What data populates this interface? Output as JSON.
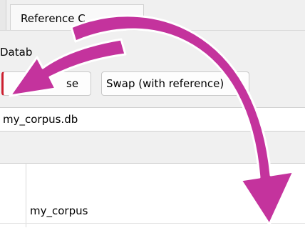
{
  "tabs": [
    {
      "label": "Reference C"
    }
  ],
  "database": {
    "label": "Datab",
    "browse_label": "se",
    "swap_label": "Swap (with reference)",
    "path_value": "my_corpus.db"
  },
  "table": {
    "cell_value": "my_corpus"
  },
  "colors": {
    "arrow_fill": "#c4339d",
    "arrow_stroke": "#ffffff",
    "accent_red": "#cc1f2f"
  }
}
